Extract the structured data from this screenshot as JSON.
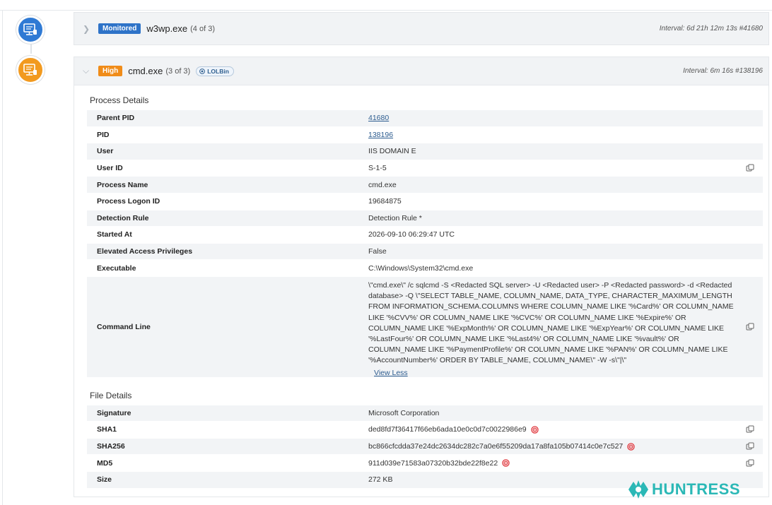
{
  "timeline": [
    {
      "badge": "Monitored",
      "badge_color": "#2e73c8",
      "title": "w3wp.exe",
      "count": "(4 of 3)",
      "interval": "Interval: 6d 21h 12m 13s #41680",
      "node_color": "#2f7ad4"
    },
    {
      "badge": "High",
      "badge_color": "#f08c19",
      "title": "cmd.exe",
      "count": "(3 of 3)",
      "tag": "LOLBin",
      "interval": "Interval: 6m 16s #138196",
      "node_color": "#f29a1f"
    }
  ],
  "process_details": {
    "title": "Process Details",
    "rows": [
      {
        "label": "Parent PID",
        "value": "41680"
      },
      {
        "label": "PID",
        "value": "138196"
      },
      {
        "label": "User",
        "value": "IIS DOMAIN E"
      },
      {
        "label": "User ID",
        "value": "S-1-5"
      },
      {
        "label": "Process Name",
        "value": "cmd.exe"
      },
      {
        "label": "Process Logon ID",
        "value": "19684875"
      },
      {
        "label": "Detection Rule",
        "value": "Detection Rule *"
      },
      {
        "label": "Started At",
        "value": "2026-09-10 06:29:47 UTC"
      },
      {
        "label": "Elevated Access Privileges",
        "value": "False"
      },
      {
        "label": "Executable",
        "value": "C:\\Windows\\System32\\cmd.exe"
      },
      {
        "label": "Command Line",
        "value": "\\\"cmd.exe\\\" /c sqlcmd -S <Redacted SQL server> -U <Redacted user> -P <Redacted password> -d <Redacted database> -Q \\\"SELECT TABLE_NAME, COLUMN_NAME, DATA_TYPE, CHARACTER_MAXIMUM_LENGTH FROM INFORMATION_SCHEMA.COLUMNS WHERE COLUMN_NAME LIKE '%Card%' OR COLUMN_NAME LIKE '%CVV%' OR COLUMN_NAME LIKE '%CVC%' OR COLUMN_NAME LIKE '%Expire%' OR COLUMN_NAME LIKE '%ExpMonth%' OR COLUMN_NAME LIKE '%ExpYear%' OR COLUMN_NAME LIKE '%LastFour%' OR COLUMN_NAME LIKE '%Last4%' OR COLUMN_NAME LIKE '%vault%' OR COLUMN_NAME LIKE '%PaymentProfile%' OR COLUMN_NAME LIKE '%PAN%' OR COLUMN_NAME LIKE '%AccountNumber%' ORDER BY TABLE_NAME, COLUMN_NAME\\\" -W -s\\\"|\\\"",
        "toggle": "View Less"
      }
    ]
  },
  "file_details": {
    "title": "File Details",
    "rows": [
      {
        "label": "Signature",
        "value": "Microsoft Corporation"
      },
      {
        "label": "SHA1",
        "value": "ded8fd7f36417f66eb6ada10e0c0d7c0022986e9"
      },
      {
        "label": "SHA256",
        "value": "bc866cfcdda37e24dc2634dc282c7a0e6f55209da17a8fa105b07414c0e7c527"
      },
      {
        "label": "MD5",
        "value": "911d039e71583a07320b32bde22f8e22"
      },
      {
        "label": "Size",
        "value": "272 KB"
      }
    ]
  },
  "brand": {
    "name": "HUNTRESS",
    "color": "#2bb8b6"
  }
}
